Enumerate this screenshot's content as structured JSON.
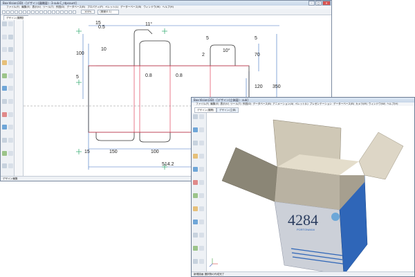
{
  "main_window": {
    "title": "Box-Vision(3D) - [デザイン(展開図)  - 3-sub.C_ntpcount]",
    "menu": [
      "ファイル(F)",
      "編集(E)",
      "表示(V)",
      "ツール(T)",
      "作図(D)",
      "データベース(B)",
      "プロパティ(P)",
      "ペレット(L)",
      "データーベース(B)",
      "ウィンドウ(W)",
      "ヘルプ(H)"
    ],
    "zoom_value": "100%",
    "style_value": "(実線/0.1)",
    "tab_label": "デザイン(展開図)",
    "status_text": "デザイン編集"
  },
  "dimensions": {
    "d15_top": "15",
    "d05": "0.5",
    "d11": "11°",
    "d10a": "10",
    "d100": "100",
    "d5_left": "5",
    "d5a": "5",
    "d5b": "5",
    "d10b": "10°",
    "d2": "2",
    "d70": "70",
    "d08a": "0.8",
    "d08b": "0.8",
    "d120": "120",
    "d350": "350",
    "d15_bl": "15",
    "d150": "150",
    "d100_b": "100",
    "d15_br": "15",
    "d5142": "514.2"
  },
  "sub_window": {
    "title": "Box-Vision(3D) - [デザイン(立体図) - sub]",
    "menu": [
      "ファイル(F)",
      "編集(E)",
      "表示(V)",
      "ツール(T)",
      "作図(D)",
      "データベース(B)",
      "アニメーション(A)",
      "ペレット(L)",
      "プレゼンテーション",
      "データーベース(B)",
      "カメラ(M)",
      "ウィンドウ(W)",
      "ヘルプ(H)"
    ],
    "tab_a": "デザイン(展開)",
    "tab_b": "デザイン(立体)",
    "box_number": "4284",
    "box_brand": "PORTONAKAI",
    "status_text": "新規描画  選択物の作成完了"
  },
  "colors": {
    "accent": "#2a5aa8",
    "cut_line": "#333333",
    "fold_line": "#e0405a",
    "box_side": "#c9cdd6",
    "box_inside": "#ddd6c6",
    "box_blue": "#2f66b8"
  }
}
